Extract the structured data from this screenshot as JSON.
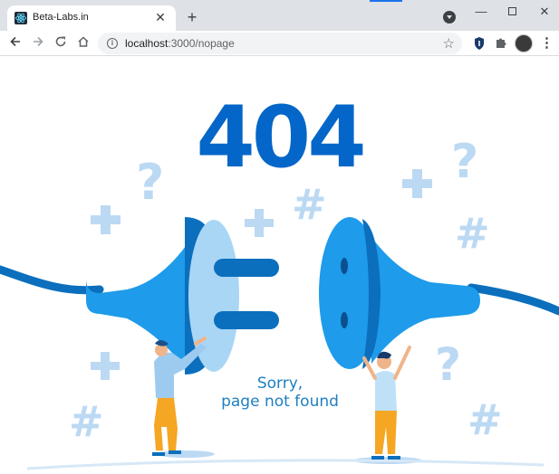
{
  "browser": {
    "tab_title": "Beta-Labs.in",
    "tab_close_icon": "close-icon",
    "new_tab_label": "+",
    "window_controls": {
      "minimize": "—",
      "maximize": "restore-icon",
      "close": "✕"
    },
    "url_host": "localhost",
    "url_port_path": ":3000/nopage"
  },
  "page": {
    "heading": "404",
    "message_line1": "Sorry,",
    "message_line2": "page not found"
  },
  "colors": {
    "primary_blue": "#0466c8",
    "plug_blue": "#1e9bea",
    "plug_light": "#a9d6f5",
    "symbol_light": "#bcd9f3",
    "message_blue": "#1e7fc1",
    "pants_orange": "#f5a623"
  }
}
